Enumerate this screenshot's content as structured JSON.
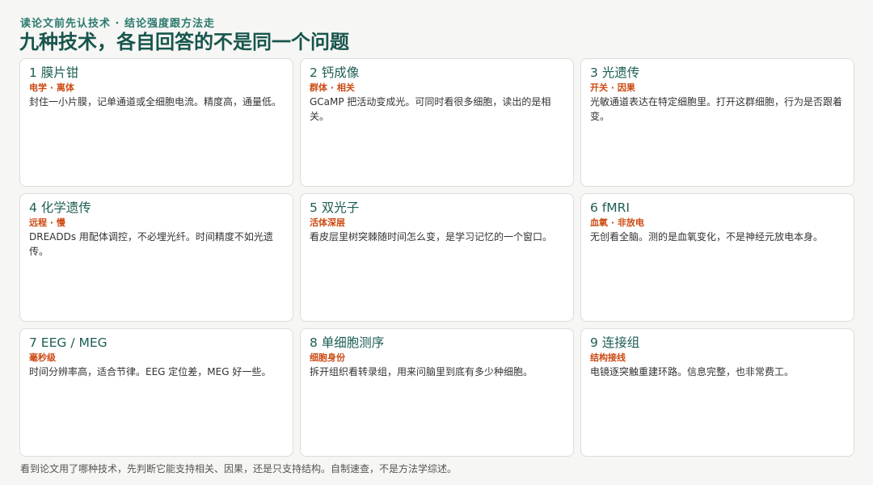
{
  "header": {
    "eyebrow": "读论文前先认技术 · 结论强度跟方法走",
    "title": "九种技术，各自回答的不是同一个问题"
  },
  "cards": [
    {
      "title": "1 膜片钳",
      "tag": "电学 · 离体",
      "desc": "封住一小片膜，记单通道或全细胞电流。精度高，通量低。"
    },
    {
      "title": "2 钙成像",
      "tag": "群体 · 相关",
      "desc": "GCaMP 把活动变成光。可同时看很多细胞，读出的是相关。"
    },
    {
      "title": "3 光遗传",
      "tag": "开关 · 因果",
      "desc": "光敏通道表达在特定细胞里。打开这群细胞，行为是否跟着变。"
    },
    {
      "title": "4 化学遗传",
      "tag": "远程 · 慢",
      "desc": "DREADDs 用配体调控，不必埋光纤。时间精度不如光遗传。"
    },
    {
      "title": "5 双光子",
      "tag": "活体深层",
      "desc": "看皮层里树突棘随时间怎么变，是学习记忆的一个窗口。"
    },
    {
      "title": "6 fMRI",
      "tag": "血氧 · 非放电",
      "desc": "无创看全脑。测的是血氧变化，不是神经元放电本身。"
    },
    {
      "title": "7 EEG / MEG",
      "tag": "毫秒级",
      "desc": "时间分辨率高，适合节律。EEG 定位差，MEG 好一些。"
    },
    {
      "title": "8 单细胞测序",
      "tag": "细胞身份",
      "desc": "拆开组织看转录组，用来问脑里到底有多少种细胞。"
    },
    {
      "title": "9 连接组",
      "tag": "结构接线",
      "desc": "电镜逐突触重建环路。信息完整，也非常费工。"
    }
  ],
  "footer": {
    "note": "看到论文用了哪种技术，先判断它能支持相关、因果，还是只支持结构。自制速查，不是方法学综述。"
  }
}
